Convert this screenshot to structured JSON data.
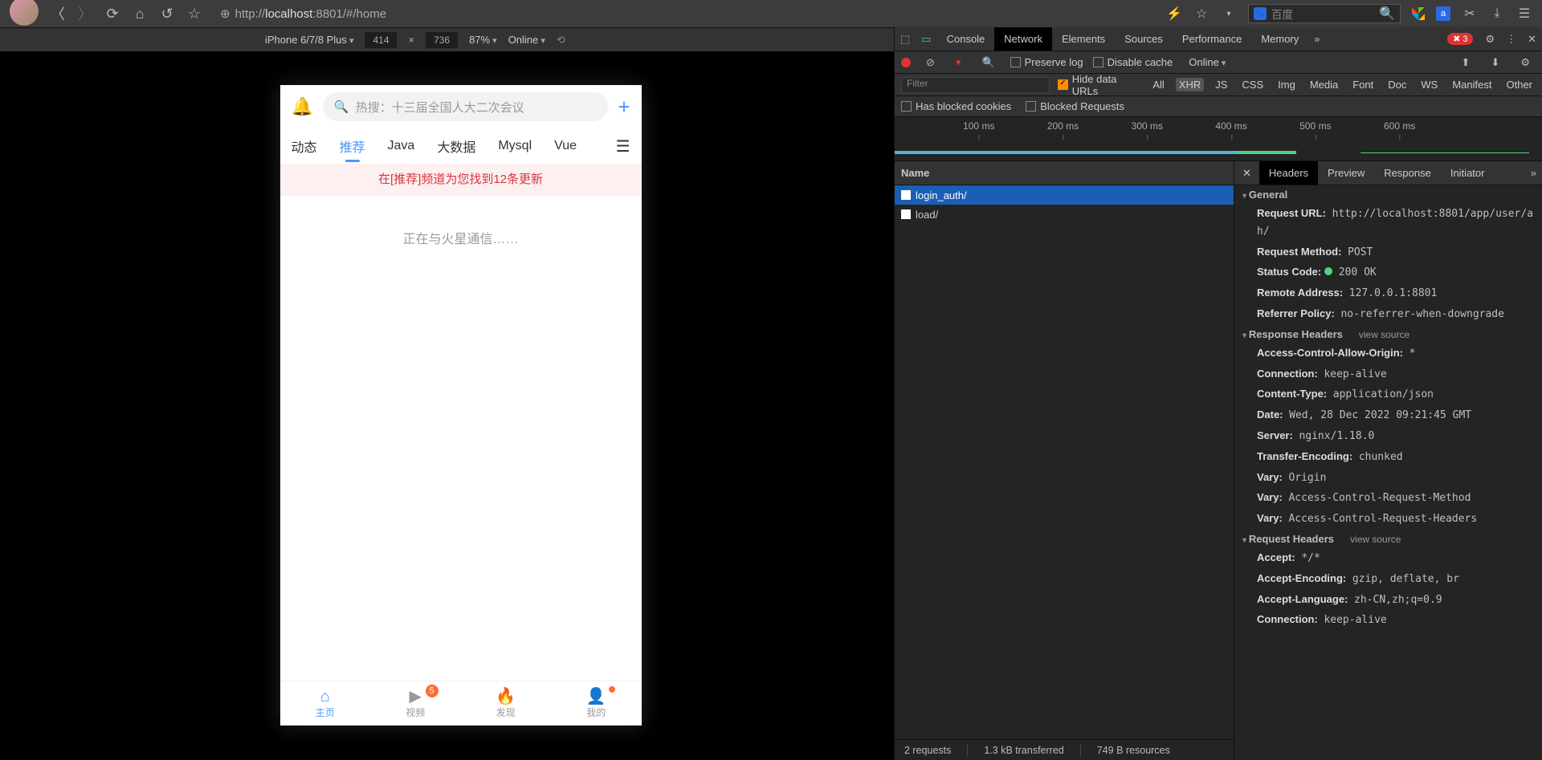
{
  "browser": {
    "url_prefix": "http://",
    "url_host": "localhost",
    "url_rest": ":8801/#/home",
    "search_placeholder": "百度"
  },
  "device_bar": {
    "device": "iPhone 6/7/8 Plus",
    "width": "414",
    "height": "736",
    "zoom": "87%",
    "throttle": "Online"
  },
  "app": {
    "search_hint": "热搜：十三届全国人大二次会议",
    "tabs": [
      {
        "label": "动态"
      },
      {
        "label": "推荐",
        "active": true
      },
      {
        "label": "Java"
      },
      {
        "label": "大数据"
      },
      {
        "label": "Mysql"
      },
      {
        "label": "Vue"
      }
    ],
    "notice": "在[推荐]频道为您找到12条更新",
    "loading": "正在与火星通信……",
    "bottom": [
      {
        "label": "主页",
        "active": true
      },
      {
        "label": "视频",
        "badge": "5"
      },
      {
        "label": "发现"
      },
      {
        "label": "我的",
        "dot": true
      }
    ]
  },
  "devtools": {
    "tabs": [
      "Console",
      "Network",
      "Elements",
      "Sources",
      "Performance",
      "Memory"
    ],
    "active_tab": "Network",
    "errors": "3",
    "toolbar": {
      "preserve": "Preserve log",
      "disable_cache": "Disable cache",
      "online": "Online"
    },
    "filter": {
      "placeholder": "Filter",
      "hide_urls": "Hide data URLs",
      "types": [
        "All",
        "XHR",
        "JS",
        "CSS",
        "Img",
        "Media",
        "Font",
        "Doc",
        "WS",
        "Manifest",
        "Other"
      ],
      "active_type": "XHR",
      "has_blocked": "Has blocked cookies",
      "blocked_req": "Blocked Requests"
    },
    "timeline": [
      "100 ms",
      "200 ms",
      "300 ms",
      "400 ms",
      "500 ms",
      "600 ms"
    ],
    "requests": {
      "header": "Name",
      "rows": [
        {
          "name": "login_auth/",
          "selected": true
        },
        {
          "name": "load/"
        }
      ]
    },
    "detail": {
      "tabs": [
        "Headers",
        "Preview",
        "Response",
        "Initiator"
      ],
      "active": "Headers",
      "general_title": "General",
      "general": [
        {
          "k": "Request URL:",
          "v": "http://localhost:8801/app/user/a\nh/"
        },
        {
          "k": "Request Method:",
          "v": "POST"
        },
        {
          "k": "Status Code:",
          "v": "200 OK",
          "status": true
        },
        {
          "k": "Remote Address:",
          "v": "127.0.0.1:8801"
        },
        {
          "k": "Referrer Policy:",
          "v": "no-referrer-when-downgrade"
        }
      ],
      "response_title": "Response Headers",
      "response": [
        {
          "k": "Access-Control-Allow-Origin:",
          "v": "*"
        },
        {
          "k": "Connection:",
          "v": "keep-alive"
        },
        {
          "k": "Content-Type:",
          "v": "application/json"
        },
        {
          "k": "Date:",
          "v": "Wed, 28 Dec 2022 09:21:45 GMT"
        },
        {
          "k": "Server:",
          "v": "nginx/1.18.0"
        },
        {
          "k": "Transfer-Encoding:",
          "v": "chunked"
        },
        {
          "k": "Vary:",
          "v": "Origin"
        },
        {
          "k": "Vary:",
          "v": "Access-Control-Request-Method"
        },
        {
          "k": "Vary:",
          "v": "Access-Control-Request-Headers"
        }
      ],
      "request_title": "Request Headers",
      "request": [
        {
          "k": "Accept:",
          "v": "*/*"
        },
        {
          "k": "Accept-Encoding:",
          "v": "gzip, deflate, br"
        },
        {
          "k": "Accept-Language:",
          "v": "zh-CN,zh;q=0.9"
        },
        {
          "k": "Connection:",
          "v": "keep-alive"
        }
      ],
      "view_source": "view source"
    },
    "status": {
      "requests": "2 requests",
      "transferred": "1.3 kB transferred",
      "resources": "749 B resources"
    }
  }
}
